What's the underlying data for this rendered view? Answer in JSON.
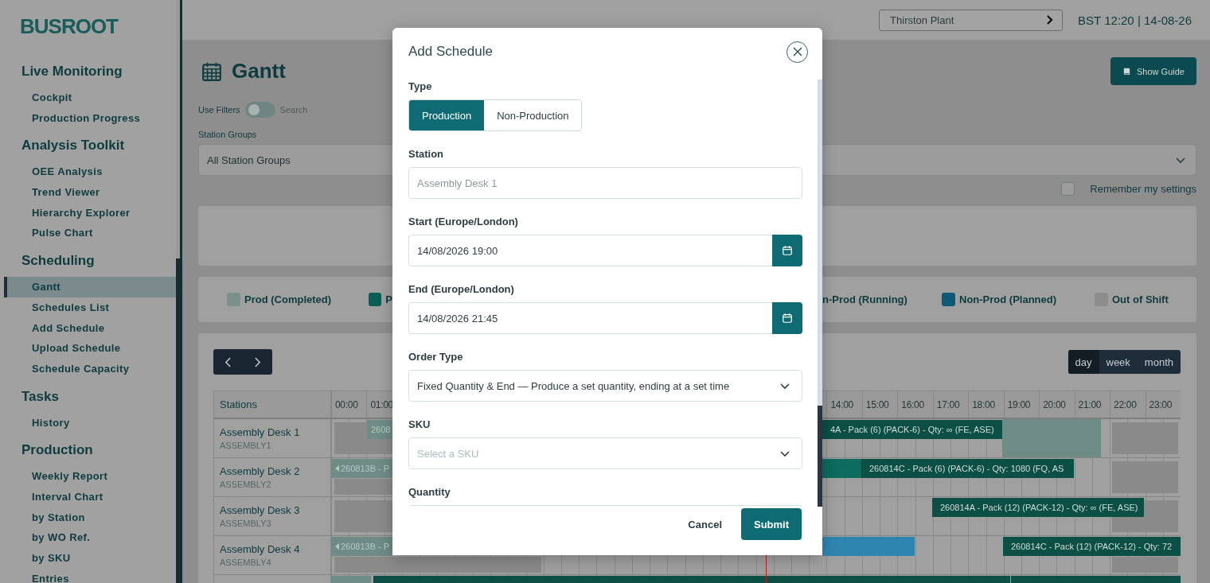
{
  "sidebar": {
    "logo": "BUSROOT",
    "sections": [
      {
        "title": "Live Monitoring",
        "items": [
          {
            "label": "Cockpit",
            "selected": false
          },
          {
            "label": "Production Progress",
            "selected": false
          }
        ]
      },
      {
        "title": "Analysis Toolkit",
        "items": [
          {
            "label": "OEE Analysis",
            "selected": false
          },
          {
            "label": "Trend Viewer",
            "selected": false
          },
          {
            "label": "Hierarchy Explorer",
            "selected": false
          },
          {
            "label": "Pulse Chart",
            "selected": false
          }
        ]
      },
      {
        "title": "Scheduling",
        "items": [
          {
            "label": "Gantt",
            "selected": true
          },
          {
            "label": "Schedules List",
            "selected": false
          },
          {
            "label": "Add Schedule",
            "selected": false
          },
          {
            "label": "Upload Schedule",
            "selected": false
          },
          {
            "label": "Schedule Capacity",
            "selected": false
          }
        ]
      },
      {
        "title": "Tasks",
        "items": [
          {
            "label": "History",
            "selected": false
          }
        ]
      },
      {
        "title": "Production",
        "items": [
          {
            "label": "Weekly Report",
            "selected": false
          },
          {
            "label": "Interval Chart",
            "selected": false
          },
          {
            "label": "by Station",
            "selected": false
          },
          {
            "label": "by WO Ref.",
            "selected": false
          },
          {
            "label": "by SKU",
            "selected": false
          },
          {
            "label": "Entries",
            "selected": false
          }
        ]
      }
    ]
  },
  "topbar": {
    "plant": "Thirston Plant",
    "clock": "BST 12:20 | 14-08-26"
  },
  "page": {
    "title": "Gantt",
    "guide_button": "Show Guide",
    "filters": {
      "label": "Use Filters",
      "on": false,
      "search_label": "Search"
    },
    "station_groups": {
      "label": "Station Groups",
      "value": "All Station Groups"
    },
    "remember": {
      "label": "Remember my settings",
      "checked": false
    }
  },
  "legend": [
    {
      "label": "Prod (Completed)",
      "color": "#7b8f8b"
    },
    {
      "label": "P",
      "color": "#0a5e55"
    },
    {
      "label": "n-Prod (Running)"
    },
    {
      "label": "Non-Prod (Planned)",
      "color": "#0c5a78"
    },
    {
      "label": "Out of Shift",
      "color": "#8c8c8c"
    }
  ],
  "gantt": {
    "views": [
      {
        "label": "day",
        "selected": true
      },
      {
        "label": "week",
        "selected": false
      },
      {
        "label": "month",
        "selected": false
      }
    ],
    "stations_header": "Stations",
    "hours": [
      "00:00",
      "01:00",
      "14:00",
      "15:00",
      "16:00",
      "17:00",
      "18:00",
      "19:00",
      "20:00",
      "21:00",
      "22:00",
      "23:00"
    ],
    "rows": [
      {
        "name": "Assembly Desk 1",
        "code": "ASSEMBLY1",
        "bars": [
          {
            "kind": "off-shift"
          },
          {
            "kind": "completed",
            "text": "2608",
            "continued": false
          },
          {
            "kind": "production",
            "text": "4A - Pack (6) (PACK-6) - Qty: ∞   (FE, ASE)",
            "continued": false
          },
          {
            "kind": "completed",
            "continued": false
          },
          {
            "kind": "off-shift"
          }
        ]
      },
      {
        "name": "Assembly Desk 2",
        "code": "ASSEMBLY2",
        "bars": [
          {
            "kind": "off-shift"
          },
          {
            "kind": "completed",
            "text": "260813B - P",
            "continued": true
          },
          {
            "kind": "running",
            "continued": false
          },
          {
            "kind": "production",
            "text": "260814C - Pack (6) (PACK-6) - Qty: 1080   (FQ, AS",
            "continued": false
          },
          {
            "kind": "off-shift"
          }
        ]
      },
      {
        "name": "Assembly Desk 3",
        "code": "ASSEMBLY3",
        "bars": [
          {
            "kind": "off-shift"
          },
          {
            "kind": "off-shift"
          },
          {
            "kind": "production",
            "text": "260814A - Pack (12) (PACK-12) - Qty: ∞   (FE, ASE)",
            "continued": false
          }
        ]
      },
      {
        "name": "Assembly Desk 4",
        "code": "ASSEMBLY4",
        "bars": [
          {
            "kind": "off-shift"
          },
          {
            "kind": "completed",
            "text": "260813B - P",
            "continued": true
          },
          {
            "kind": "non-production",
            "continued": false
          },
          {
            "kind": "off-shift"
          },
          {
            "kind": "production",
            "text": "260814C - Pack (12) (PACK-12) - Qty: 72",
            "continued": false
          }
        ]
      },
      {
        "bars": [
          {
            "kind": "completed"
          },
          {
            "kind": "production"
          },
          {
            "kind": "production"
          }
        ]
      }
    ]
  },
  "modal": {
    "title": "Add Schedule",
    "fields": [
      {
        "kind": "segmented",
        "label": "Type",
        "options": [
          {
            "label": "Production",
            "selected": true
          },
          {
            "label": "Non-Production",
            "selected": false
          }
        ]
      },
      {
        "kind": "text",
        "label": "Station",
        "placeholder": "Assembly Desk 1"
      },
      {
        "kind": "date",
        "label": "Start (Europe/London)",
        "value": "14/08/2026 19:00"
      },
      {
        "kind": "date",
        "label": "End (Europe/London)",
        "value": "14/08/2026 21:45"
      },
      {
        "kind": "select",
        "label": "Order Type",
        "value": "Fixed Quantity & End — Produce a set quantity, ending at a set time"
      },
      {
        "kind": "select",
        "label": "SKU",
        "placeholder": "Select a SKU"
      },
      {
        "kind": "text",
        "label": "Quantity"
      }
    ],
    "cancel": "Cancel",
    "submit": "Submit"
  }
}
